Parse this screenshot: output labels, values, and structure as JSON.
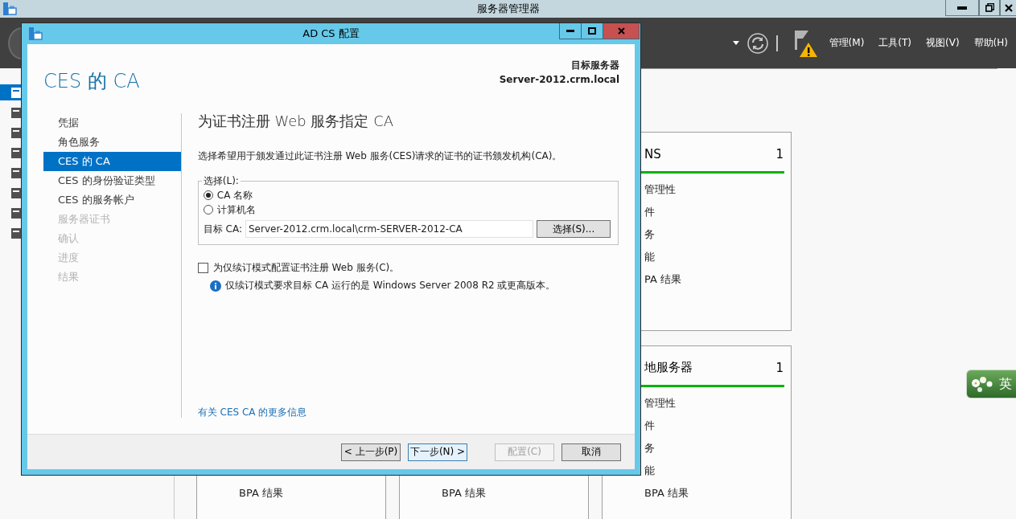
{
  "app": {
    "title": "服务器管理器",
    "menus": [
      "管理(M)",
      "工具(T)",
      "视图(V)",
      "帮助(H)"
    ]
  },
  "nav_items": [
    {
      "selected": true
    },
    {
      "selected": false
    },
    {
      "selected": false
    },
    {
      "selected": false
    },
    {
      "selected": false
    },
    {
      "selected": false
    },
    {
      "selected": false
    },
    {
      "selected": false
    }
  ],
  "tile_rows": [
    [
      {
        "heading": "NS",
        "count": "1",
        "items": [
          "管理性",
          "件",
          "务",
          "能",
          "PA 结果"
        ]
      }
    ],
    [
      {
        "items": [
          "BPA 结果"
        ]
      },
      {
        "items": [
          "BPA 结果"
        ]
      },
      {
        "heading": "地服务器",
        "count": "1",
        "items": [
          "管理性",
          "件",
          "务",
          "能",
          "BPA 结果"
        ]
      }
    ]
  ],
  "dialog": {
    "title": "AD CS 配置",
    "page_title": "CES 的 CA",
    "target_label": "目标服务器",
    "target_server": "Server-2012.crm.local",
    "steps": [
      {
        "label": "凭据",
        "selected": false,
        "disabled": false
      },
      {
        "label": "角色服务",
        "selected": false,
        "disabled": false
      },
      {
        "label": "CES 的 CA",
        "selected": true,
        "disabled": false
      },
      {
        "label": "CES 的身份验证类型",
        "selected": false,
        "disabled": false
      },
      {
        "label": "CES 的服务帐户",
        "selected": false,
        "disabled": false
      },
      {
        "label": "服务器证书",
        "selected": false,
        "disabled": true
      },
      {
        "label": "确认",
        "selected": false,
        "disabled": true
      },
      {
        "label": "进度",
        "selected": false,
        "disabled": true
      },
      {
        "label": "结果",
        "selected": false,
        "disabled": true
      }
    ],
    "heading": "为证书注册 Web 服务指定 CA",
    "description": "选择希望用于颁发通过此证书注册 Web 服务(CES)请求的证书的证书颁发机构(CA)。",
    "group_label": "选择(L):",
    "options": [
      {
        "label": "CA 名称",
        "selected": true
      },
      {
        "label": "计算机名",
        "selected": false
      }
    ],
    "target_ca_label": "目标 CA:",
    "target_ca": "Server-2012.crm.local\\crm-SERVER-2012-CA",
    "select_button": "选择(S)...",
    "renewal_option": {
      "label": "为仅续订模式配置证书注册 Web 服务(C)。",
      "checked": false
    },
    "note": "仅续订模式要求目标 CA 运行的是 Windows Server 2008 R2 或更高版本。",
    "more_info_link": "有关 CES CA 的更多信息",
    "buttons": [
      {
        "label": "< 上一步(P)",
        "default": false,
        "disabled": false
      },
      {
        "label": "下一步(N) >",
        "default": true,
        "disabled": false
      },
      {
        "label": "配置(C)",
        "default": false,
        "disabled": true
      },
      {
        "label": "取消",
        "default": false,
        "disabled": false
      }
    ]
  },
  "ime": {
    "label": "英"
  }
}
